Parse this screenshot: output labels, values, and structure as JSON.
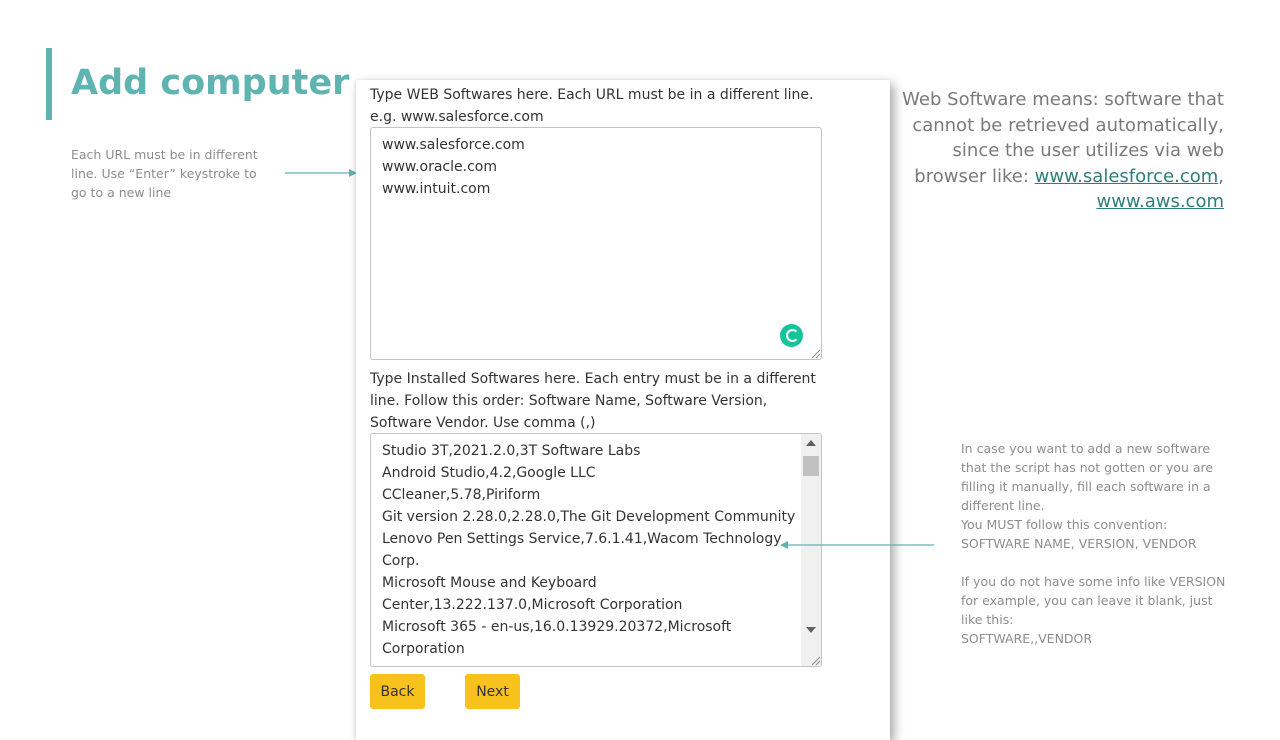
{
  "slide": {
    "title": "Add computer",
    "left_note": "Each URL must be in different line. Use “Enter” keystroke to go to a new line",
    "web_note": {
      "text": "Web Software means: software that cannot be retrieved automatically, since the user utilizes via web browser like: ",
      "link1": "www.salesforce.com",
      "separator": ",",
      "link2": "www.aws.com"
    },
    "right_note": {
      "p1": "In case you want to add a new software that the script has not gotten or you are filling it manually, fill each software in a different line.",
      "p2": "You MUST follow this convention:",
      "p3": "SOFTWARE NAME, VERSION, VENDOR",
      "p4": "If you do not have some info like VERSION for example, you can leave it blank, just like this:",
      "p5": "SOFTWARE,,VENDOR"
    },
    "colors": {
      "accent": "#5fb3b0",
      "button": "#f8c21c",
      "grammarly": "#15c39a"
    }
  },
  "form": {
    "web_label": "Type WEB Softwares here. Each URL must be in a different line. e.g. www.salesforce.com",
    "web_lines": [
      "www.salesforce.com",
      "www.oracle.com",
      "www.intuit.com"
    ],
    "installed_label": "Type Installed Softwares here. Each entry must be in a different line. Follow this order: Software Name, Software Version, Software Vendor. Use comma (,)",
    "installed_lines": [
      "Studio 3T,2021.2.0,3T Software Labs",
      "Android Studio,4.2,Google LLC",
      "CCleaner,5.78,Piriform",
      "Git version 2.28.0,2.28.0,The Git Development Community",
      "Lenovo Pen Settings Service,7.6.1.41,Wacom Technology Corp.",
      "Microsoft Mouse and Keyboard Center,13.222.137.0,Microsoft Corporation",
      "Microsoft 365 - en-us,16.0.13929.20372,Microsoft Corporation"
    ],
    "back_label": "Back",
    "next_label": "Next"
  },
  "icons": [
    "grammarly-icon",
    "resize-grip-icon",
    "scroll-up-arrow-icon",
    "scroll-down-arrow-icon",
    "arrow-icon"
  ]
}
